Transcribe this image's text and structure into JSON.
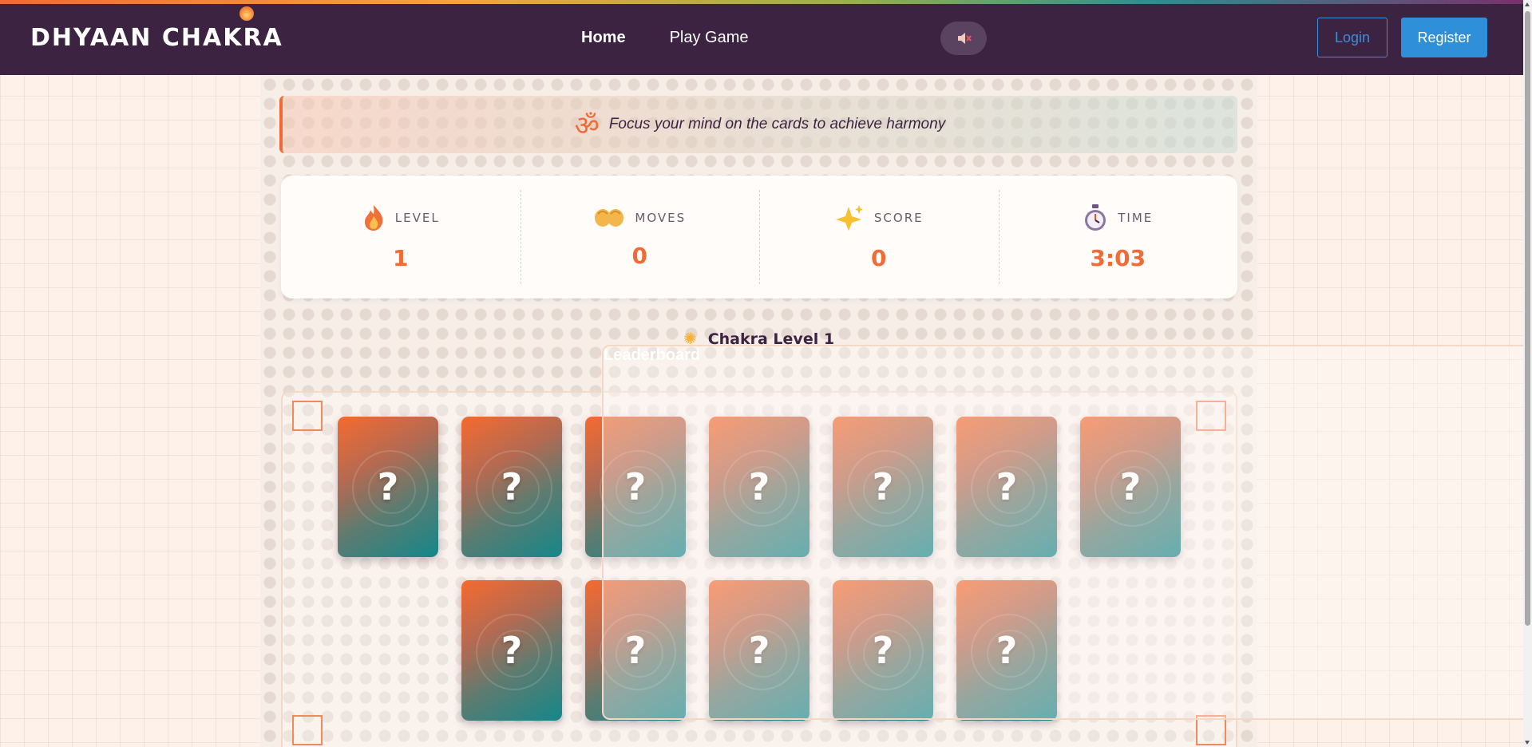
{
  "header": {
    "logo": "DHYAAN CHAKRA",
    "nav": [
      "Home",
      "Play Game",
      "Leaderboard"
    ],
    "sound_icon": "mute-speaker-icon",
    "login_label": "Login",
    "register_label": "Register"
  },
  "quote": {
    "icon": "om-icon",
    "text": "Focus your mind on the cards to achieve harmony"
  },
  "stats": [
    {
      "icon": "fire-icon",
      "label": "LEVEL",
      "value": "1"
    },
    {
      "icon": "open-hands-icon",
      "label": "MOVES",
      "value": "0"
    },
    {
      "icon": "sparkles-icon",
      "label": "SCORE",
      "value": "0"
    },
    {
      "icon": "stopwatch-icon",
      "label": "TIME",
      "value": "3:03"
    }
  ],
  "level_title": "Chakra Level 1",
  "cards": [
    {
      "face": "?"
    },
    {
      "face": "?"
    },
    {
      "face": "?"
    },
    {
      "face": "?"
    },
    {
      "face": "?"
    },
    {
      "face": "?"
    },
    {
      "face": "?"
    },
    {
      "face": "?"
    },
    {
      "face": "?"
    },
    {
      "face": "?"
    },
    {
      "face": "?"
    },
    {
      "face": "?"
    }
  ],
  "colors": {
    "header_bg": "#3c2342",
    "accent": "#f26a35",
    "register_bg": "#2f8fd8",
    "card_gradient_start": "#f56a2f",
    "card_gradient_end": "#14878a"
  }
}
